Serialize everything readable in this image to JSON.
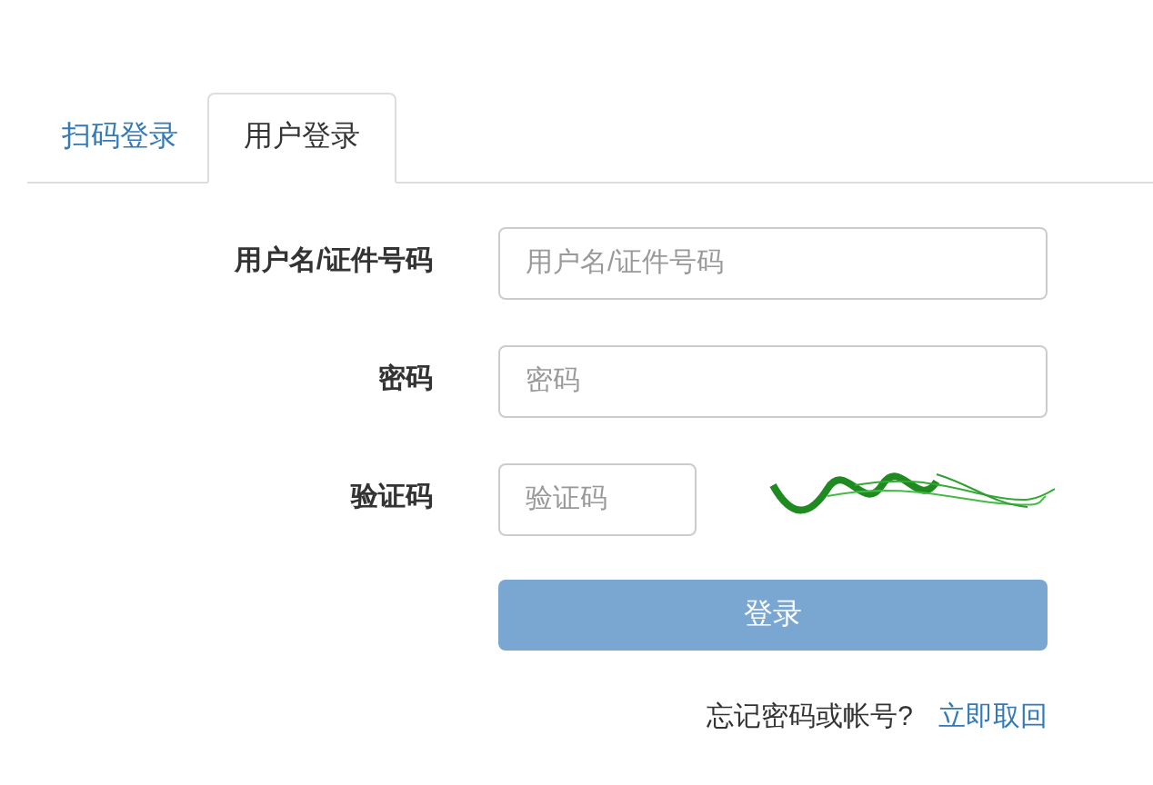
{
  "tabs": [
    {
      "label": "扫码登录",
      "selected": false
    },
    {
      "label": "用户登录",
      "selected": true
    }
  ],
  "form": {
    "fields": [
      {
        "label": "用户名/证件号码",
        "placeholder": "用户名/证件号码",
        "kind": "text"
      },
      {
        "label": "密码",
        "placeholder": "密码",
        "kind": "password"
      },
      {
        "label": "验证码",
        "placeholder": "验证码",
        "kind": "captcha"
      }
    ],
    "submit": "登录",
    "forgot_text": "忘记密码或帐号?",
    "recover_link": "立即取回"
  }
}
